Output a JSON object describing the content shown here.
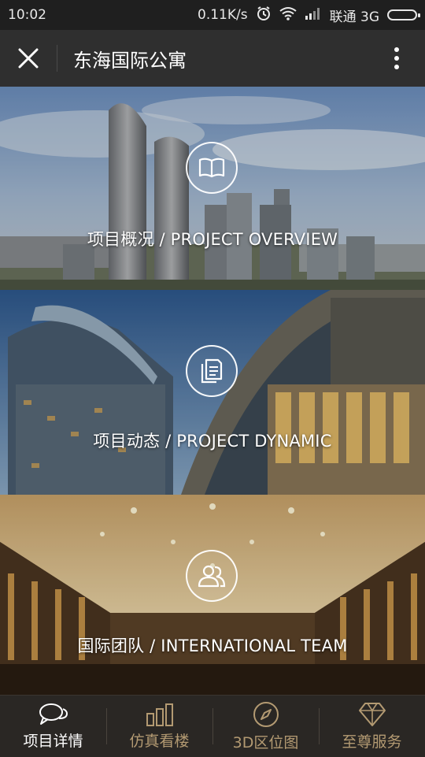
{
  "status_bar": {
    "time": "10:02",
    "network_speed": "0.11K/s",
    "carrier": "联通 3G",
    "icons": [
      "alarm-icon",
      "wifi-icon",
      "signal-icon",
      "battery-icon"
    ]
  },
  "app_bar": {
    "title": "东海国际公寓",
    "close_icon": "close-icon",
    "more_icon": "more-vertical-icon"
  },
  "panels": [
    {
      "label": "项目概况 / PROJECT OVERVIEW",
      "icon": "book-icon"
    },
    {
      "label": "项目动态 / PROJECT DYNAMIC",
      "icon": "document-icon"
    },
    {
      "label": "国际团队 / INTERNATIONAL TEAM",
      "icon": "team-icon"
    }
  ],
  "tab_bar": {
    "tabs": [
      {
        "label": "项目详情",
        "icon": "chat-icon",
        "active": true
      },
      {
        "label": "仿真看楼",
        "icon": "bar-chart-icon",
        "active": false
      },
      {
        "label": "3D区位图",
        "icon": "compass-icon",
        "active": false
      },
      {
        "label": "至尊服务",
        "icon": "diamond-icon",
        "active": false
      }
    ]
  },
  "colors": {
    "status_bar_bg": "#1f1f1f",
    "app_bar_bg": "#2f2f2f",
    "tab_bar_bg": "#2a2724",
    "tab_inactive": "#b39a72",
    "tab_active": "#ffffff"
  }
}
